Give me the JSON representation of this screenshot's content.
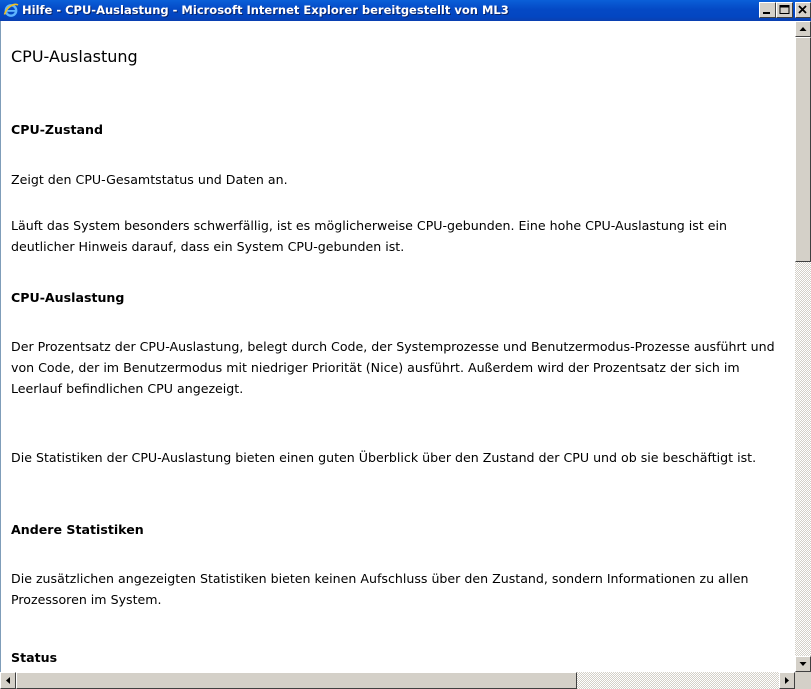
{
  "window": {
    "title": "Hilfe - CPU-Auslastung - Microsoft Internet Explorer bereitgestellt von ML3",
    "icon": "internet-explorer-icon"
  },
  "document": {
    "heading": "CPU-Auslastung",
    "sections": [
      {
        "title": "CPU-Zustand",
        "paragraphs": [
          "Zeigt den CPU-Gesamtstatus und Daten an.",
          "Läuft das System besonders schwerfällig, ist es möglicherweise CPU-gebunden. Eine hohe CPU-Auslastung ist ein deutlicher Hinweis darauf, dass ein System CPU-gebunden ist."
        ]
      },
      {
        "title": "CPU-Auslastung",
        "paragraphs": [
          "Der Prozentsatz der CPU-Auslastung, belegt durch Code, der Systemprozesse und Benutzermodus-Prozesse ausführt und von Code, der im Benutzermodus mit niedriger Priorität (Nice) ausführt. Außerdem wird der Prozentsatz der sich im Leerlauf befindlichen CPU angezeigt.",
          "Die Statistiken der CPU-Auslastung bieten einen guten Überblick über den Zustand der CPU und ob sie beschäftigt ist."
        ]
      },
      {
        "title": "Andere Statistiken",
        "paragraphs": [
          "Die zusätzlichen angezeigten Statistiken bieten keinen Aufschluss über den Zustand, sondern Informationen zu allen Prozessoren im System."
        ]
      },
      {
        "title": "Status",
        "paragraphs": []
      }
    ]
  },
  "colors": {
    "titlebar": "#0449c5",
    "background": "#ffffff",
    "chrome": "#d4d0c8"
  }
}
